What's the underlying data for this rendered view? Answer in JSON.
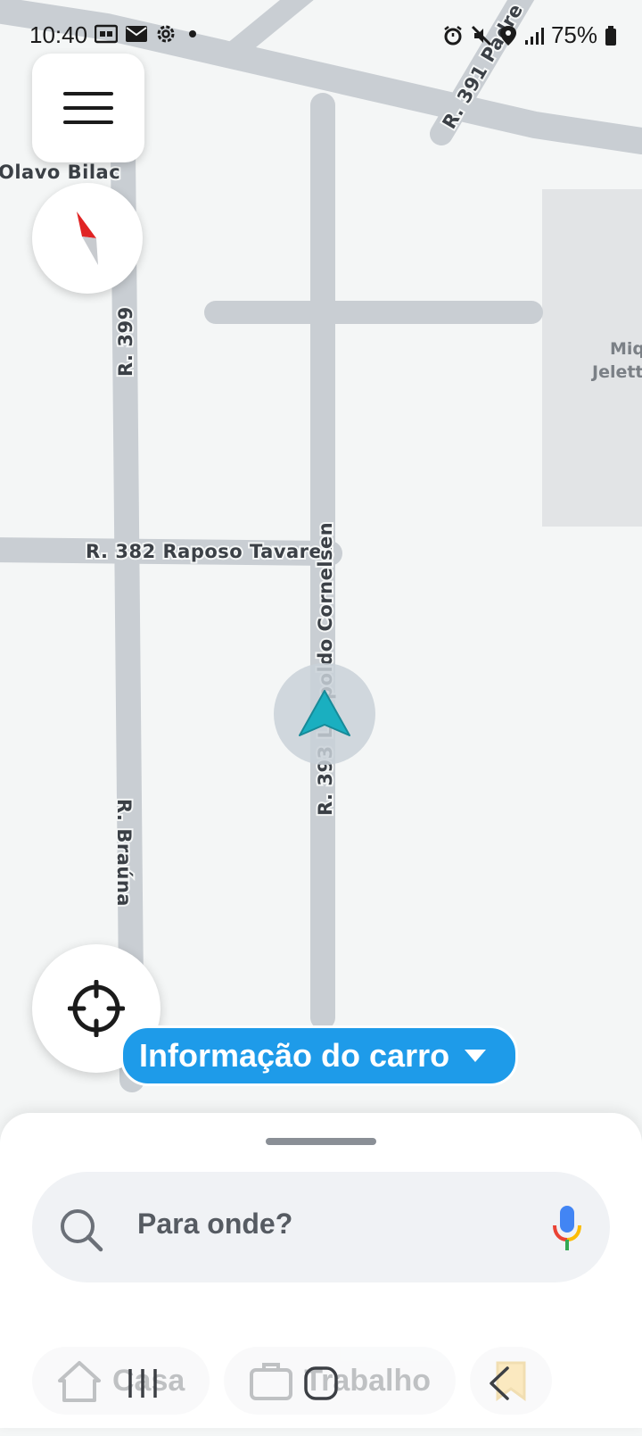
{
  "status_bar": {
    "time": "10:40",
    "left_icons": [
      "whatsapp-icon",
      "mail-icon",
      "settings-icon",
      "notification-dot-icon"
    ],
    "right_icons": [
      "alarm-icon",
      "mute-icon",
      "location-icon",
      "signal-icon"
    ],
    "battery": "75%"
  },
  "map": {
    "streets": [
      {
        "name": "Olavo Bilac"
      },
      {
        "name": "R. 391 Padre"
      },
      {
        "name": "R. 399"
      },
      {
        "name": "R. 382 Raposo Tavares"
      },
      {
        "name": "R. 393 Leopoldo Cornelsen"
      },
      {
        "name": "R. Braúna"
      }
    ],
    "poi_lines": [
      "Miq",
      "Jelett"
    ]
  },
  "buttons": {
    "menu": "menu-icon",
    "compass": "compass-icon",
    "recenter": "crosshair-icon"
  },
  "car_info": {
    "label": "Informação do carro",
    "icon": "caret-down-icon"
  },
  "search": {
    "placeholder": "Para onde?"
  },
  "shortcuts": [
    {
      "label": "Casa",
      "icon": "home-icon"
    },
    {
      "label": "Trabalho",
      "icon": "briefcase-icon"
    },
    {
      "label": "",
      "icon": "bookmark-icon"
    }
  ],
  "colors": {
    "accent": "#1e9be9",
    "location_arrow": "#1aafc0",
    "road": "#c9ced3",
    "map_background": "#f4f6f6"
  }
}
